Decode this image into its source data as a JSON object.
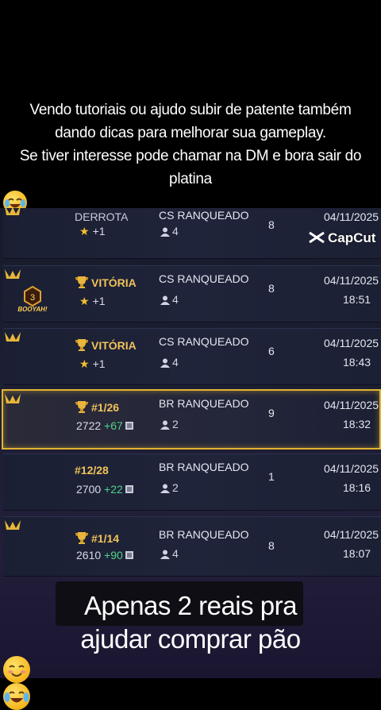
{
  "caption": {
    "line1": "Vendo tutoriais ou ajudo subir de patente também",
    "line2": "dando dicas para melhorar sua gameplay.",
    "line3": "Se tiver interesse pode chamar na DM e bora sair do",
    "line4": "platina",
    "line4_emoji": "joy-emoji"
  },
  "watermark": {
    "text": "CapCut",
    "icon": "capcut-logo-icon"
  },
  "matches": [
    {
      "result": "DERROTA",
      "sub": "+1",
      "mode": "CS RANQUEADO",
      "players": "4",
      "count": "8",
      "date": "04/11/2025",
      "time": ""
    },
    {
      "result": "VITÓRIA",
      "sub": "+1",
      "mode": "CS RANQUEADO",
      "players": "4",
      "count": "8",
      "date": "04/11/2025",
      "time": "18:51",
      "badge_number": "3",
      "badge_text": "BOOYAH!"
    },
    {
      "result": "VITÓRIA",
      "sub": "+1",
      "mode": "CS RANQUEADO",
      "players": "4",
      "count": "6",
      "date": "04/11/2025",
      "time": "18:43"
    },
    {
      "result": "#1/26",
      "sub_points": "2722",
      "sub_gain": "+67",
      "mode": "BR RANQUEADO",
      "players": "2",
      "count": "9",
      "date": "04/11/2025",
      "time": "18:32"
    },
    {
      "result": "#12/28",
      "sub_points": "2700",
      "sub_gain": "+22",
      "mode": "BR RANQUEADO",
      "players": "2",
      "count": "1",
      "date": "04/11/2025",
      "time": "18:16"
    },
    {
      "result": "#1/14",
      "sub_points": "2610",
      "sub_gain": "+90",
      "mode": "BR RANQUEADO",
      "players": "4",
      "count": "8",
      "date": "04/11/2025",
      "time": "18:07"
    }
  ],
  "bottom": {
    "line1": "Apenas 2 reais pra",
    "line2": "ajudar comprar pão",
    "emojis": [
      "smiling-face-emoji",
      "joy-emoji"
    ]
  },
  "colors": {
    "gold": "#f0c35a",
    "highlight_border": "#e0b430",
    "gain_green": "#4fd38a",
    "star": "#f3c12e"
  }
}
